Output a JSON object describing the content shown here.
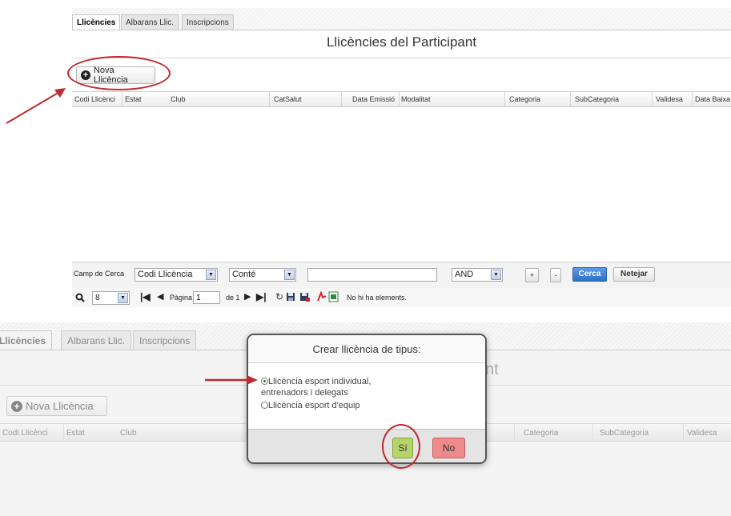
{
  "top_panel": {
    "tabs": [
      {
        "label": "Llicències",
        "active": true
      },
      {
        "label": "Albarans Llic.",
        "active": false
      },
      {
        "label": "Inscripcions",
        "active": false
      }
    ],
    "title": "Llicències del Participant",
    "new_button_label": "Nova Llicència",
    "columns": [
      "Codi Llicènci",
      "Estat",
      "Club",
      "CatSalut",
      "Data Emissió",
      "Modalitat",
      "Categoria",
      "SubCategoria",
      "Validesa",
      "Data Baixa"
    ],
    "search": {
      "label": "Camp de Cerca",
      "field_value": "Codi Llicència",
      "operator_value": "Conté",
      "text_value": "",
      "logic_value": "AND",
      "plus_label": "+",
      "minus_label": "-",
      "search_label": "Cerca",
      "clear_label": "Netejar"
    },
    "pager": {
      "page_size": "8",
      "page_label": "Pàgina",
      "page_value": "1",
      "of_label": "de 1",
      "status": "No hi ha elements."
    }
  },
  "bottom_panel": {
    "tabs": [
      {
        "label": "Llicències",
        "active": true
      },
      {
        "label": "Albarans Llic.",
        "active": false
      },
      {
        "label": "Inscripcions",
        "active": false
      }
    ],
    "title_fragment": "nt",
    "new_button_label": "Nova Llicència",
    "columns": [
      "Codi Llicènci",
      "Estat",
      "Club",
      "Categoria",
      "SubCategoria",
      "Validesa"
    ]
  },
  "modal": {
    "title": "Crear llicència de tipus:",
    "options": [
      {
        "label_line1": "Llicència esport individual,",
        "label_line2": "entrenadors i delegats",
        "selected": true
      },
      {
        "label_line1": "Llicència esport d'equip",
        "selected": false
      }
    ],
    "yes_label": "Sí",
    "no_label": "No"
  },
  "colors": {
    "annotation_red": "#c0282d",
    "yes_green": "#b5d46a",
    "no_red": "#ee8a8a",
    "search_blue": "#3a7ad0"
  }
}
